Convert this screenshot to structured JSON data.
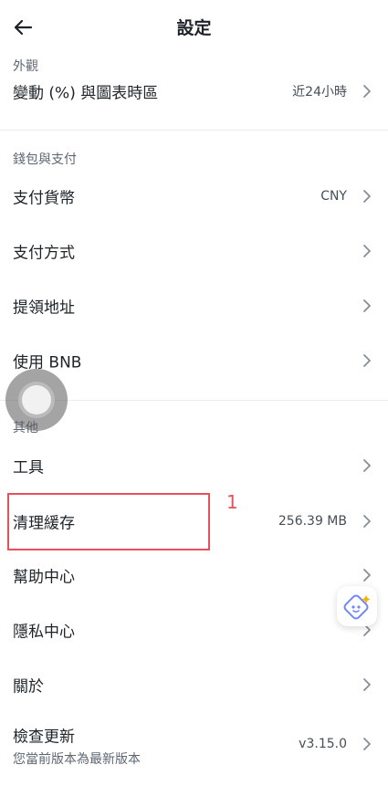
{
  "header": {
    "title": "設定"
  },
  "sections": {
    "appearance": {
      "title": "外觀"
    },
    "wallet": {
      "title": "錢包與支付"
    },
    "other": {
      "title": "其他"
    }
  },
  "rows": {
    "change": {
      "label": "變動 (%) 與圖表時區",
      "value": "近24小時"
    },
    "currency": {
      "label": "支付貨幣",
      "value": "CNY"
    },
    "method": {
      "label": "支付方式"
    },
    "address": {
      "label": "提領地址"
    },
    "bnb": {
      "label": "使用 BNB"
    },
    "tools": {
      "label": "工具"
    },
    "cache": {
      "label": "清理緩存",
      "value": "256.39 MB"
    },
    "help": {
      "label": "幫助中心"
    },
    "privacy": {
      "label": "隱私中心"
    },
    "about": {
      "label": "關於"
    },
    "update": {
      "label": "檢查更新",
      "sub": "您當前版本為最新版本",
      "value": "v3.15.0"
    }
  },
  "annotation": {
    "number": "1"
  },
  "icons": {
    "back": "arrow-left-icon",
    "chevron": "chevron-right-icon",
    "assistive": "assistive-touch-icon",
    "ai": "sparkle-face-icon"
  },
  "colors": {
    "annotation": "#e8505b",
    "accent": "#4f7cff"
  }
}
